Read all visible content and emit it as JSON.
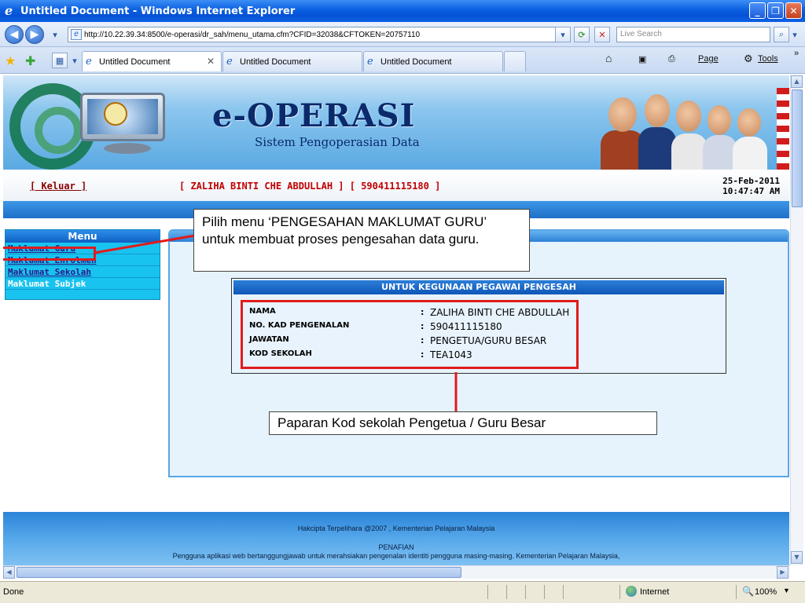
{
  "window": {
    "title": "Untitled Document - Windows Internet Explorer",
    "min": "_",
    "max": "❐",
    "close": "✕"
  },
  "address": {
    "url": "http://10.22.39.34:8500/e-operasi/dr_sah/menu_utama.cfm?CFID=32038&CFTOKEN=20757110",
    "search_placeholder": "Live Search"
  },
  "tabs": [
    {
      "label": "Untitled Document"
    },
    {
      "label": "Untitled Document"
    },
    {
      "label": "Untitled Document"
    }
  ],
  "commands": {
    "page": "Page",
    "tools": "Tools"
  },
  "banner": {
    "title": "e-OPERASI",
    "subtitle": "Sistem Pengoperasian Data"
  },
  "user": {
    "logout": "[ Keluar ]",
    "name_id": "[ ZALIHA BINTI CHE ABDULLAH ]  [ 590411115180 ]",
    "date": "25-Feb-2011",
    "time": "10:47:47 AM"
  },
  "menu": {
    "title": "Menu",
    "items": [
      {
        "label": "Maklumat Guru"
      },
      {
        "label": "Maklumat Enrolmen"
      },
      {
        "label": "Maklumat Sekolah"
      },
      {
        "label": "Maklumat Subjek"
      }
    ]
  },
  "verifier": {
    "heading": "UNTUK KEGUNAAN PEGAWAI PENGESAH",
    "rows": [
      {
        "label": "NAMA",
        "value": "ZALIHA BINTI CHE ABDULLAH"
      },
      {
        "label": "NO. KAD PENGENALAN",
        "value": "590411115180"
      },
      {
        "label": "JAWATAN",
        "value": "PENGETUA/GURU BESAR"
      },
      {
        "label": "KOD SEKOLAH",
        "value": "TEA1043"
      }
    ]
  },
  "callouts": {
    "menu_note": "Pilih menu ‘PENGESAHAN MAKLUMAT GURU’ untuk membuat proses pengesahan data guru.",
    "school_code_note": "Paparan  Kod sekolah Pengetua / Guru Besar"
  },
  "footer": {
    "copyright": "Hakcipta Terpelihara @2007 , Kementerian Pelajaran Malaysia",
    "disclaimer_title": "PENAFIAN",
    "disclaimer_text": "Pengguna aplikasi web bertanggungjawab untuk merahsiakan pengenalan identiti pengguna masing-masing. Kementerian Pelajaran Malaysia,"
  },
  "status": {
    "left": "Done",
    "zone": "Internet",
    "zoom": "100%"
  },
  "colors": {
    "accent_red": "#e11b1b",
    "menu_bg": "#19c3ef",
    "header_blue": "#1e6fc8"
  }
}
